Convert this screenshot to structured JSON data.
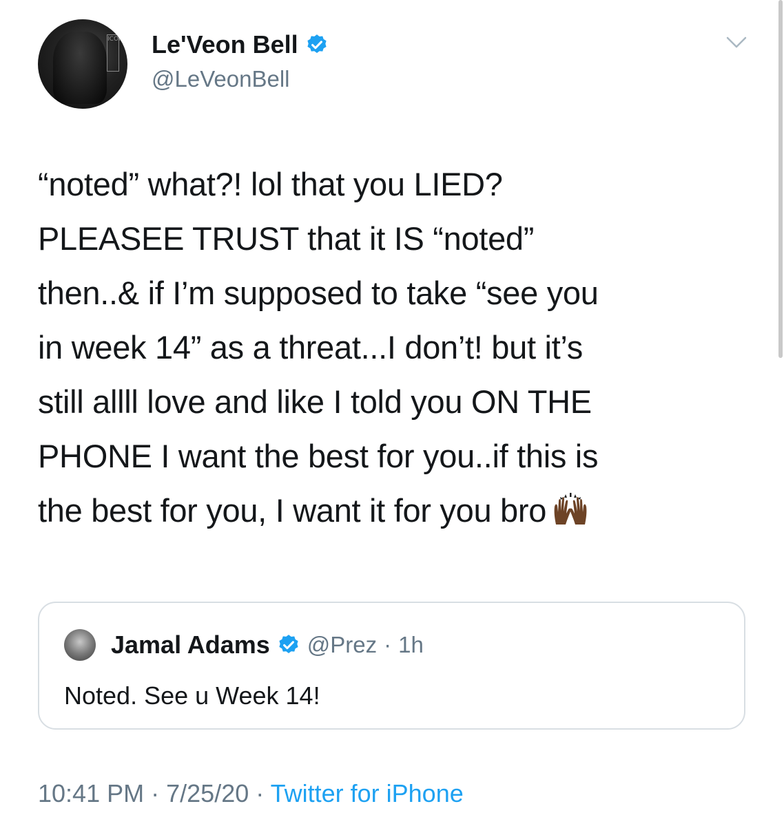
{
  "tweet": {
    "author": {
      "name": "Le'Veon Bell",
      "handle": "@LeVeonBell",
      "verified": true,
      "avatar_sign_text": "ICON"
    },
    "text_lines": [
      "“noted” what?! lol that you LIED?",
      "PLEASEE TRUST that it IS “noted”",
      "then..& if I’m supposed to take “see you",
      "in week 14” as a threat...I don’t! but it’s",
      "still allll love and like I told you ON THE",
      "PHONE I want the best for you..if this is",
      "the best for you, I want it for you bro"
    ],
    "emoji": "raising-hands-dark-skin-tone",
    "quoted": {
      "name": "Jamal Adams",
      "handle": "@Prez",
      "separator": "·",
      "time": "1h",
      "verified": true,
      "text": "Noted. See u Week 14!"
    },
    "footer": {
      "time": "10:41 PM",
      "separator": "·",
      "date": "7/25/20",
      "source": "Twitter for iPhone"
    }
  },
  "colors": {
    "text": "#14171a",
    "muted": "#657786",
    "verified_blue": "#1da1f2",
    "border": "#d8dee3"
  }
}
